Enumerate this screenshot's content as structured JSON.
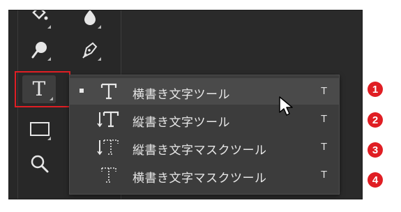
{
  "toolbar": {
    "tools": [
      {
        "icon": "paint-bucket-icon"
      },
      {
        "icon": "blur-icon"
      },
      {
        "icon": "dodge-icon"
      },
      {
        "icon": "pen-icon"
      },
      {
        "icon": "type-tool-icon",
        "glyph": "T"
      },
      {
        "icon": "rectangle-icon"
      },
      {
        "icon": "zoom-icon"
      }
    ]
  },
  "flyout": {
    "items": [
      {
        "label": "横書き文字ツール",
        "shortcut": "T",
        "icon": "horizontal-type-icon",
        "glyph": "T",
        "selected": true
      },
      {
        "label": "縦書き文字ツール",
        "shortcut": "T",
        "icon": "vertical-type-icon",
        "glyph": "↓T",
        "selected": false
      },
      {
        "label": "縦書き文字マスクツール",
        "shortcut": "T",
        "icon": "vertical-type-mask-icon",
        "glyph": "↓T",
        "selected": false
      },
      {
        "label": "横書き文字マスクツール",
        "shortcut": "T",
        "icon": "horizontal-type-mask-icon",
        "glyph": "T",
        "selected": false
      }
    ]
  },
  "annotations": [
    "1",
    "2",
    "3",
    "4"
  ],
  "colors": {
    "highlight": "#e01e24",
    "panel": "#2a2a2a",
    "menu": "#3c3c3c"
  }
}
